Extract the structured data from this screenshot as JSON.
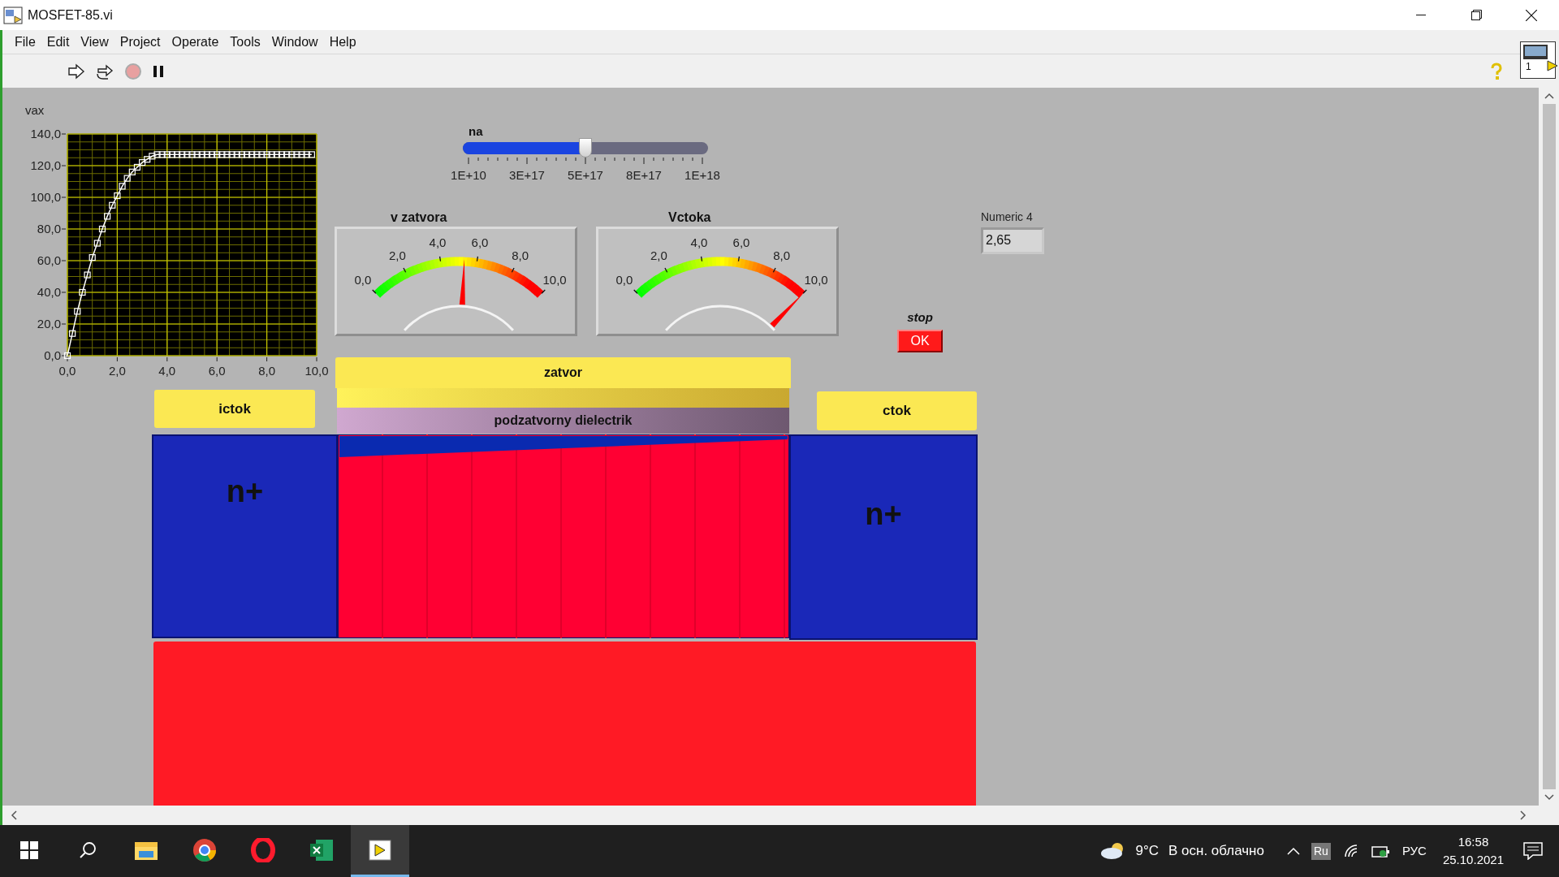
{
  "window": {
    "title": "MOSFET-85.vi",
    "vi_icon_text": "1"
  },
  "menu": [
    "File",
    "Edit",
    "View",
    "Project",
    "Operate",
    "Tools",
    "Window",
    "Help"
  ],
  "panel": {
    "graph": {
      "chart_data": {
        "type": "line",
        "grid": true,
        "x": [
          0,
          0.2,
          0.4,
          0.6,
          0.8,
          1.0,
          1.2,
          1.4,
          1.6,
          1.8,
          2.0,
          2.2,
          2.4,
          2.6,
          2.8,
          3.0,
          3.2,
          3.4,
          3.6,
          3.8,
          4.0,
          4.2,
          4.4,
          4.6,
          4.8,
          5.0,
          5.2,
          5.4,
          5.6,
          5.8,
          6.0,
          6.2,
          6.4,
          6.6,
          6.8,
          7.0,
          7.2,
          7.4,
          7.6,
          7.8,
          8.0,
          8.2,
          8.4,
          8.6,
          8.8,
          9.0,
          9.2,
          9.4,
          9.6,
          9.8
        ],
        "series": [
          {
            "name": "vax",
            "color": "#ffffff",
            "marker": "square",
            "values": [
              0,
              14,
              28,
              40,
              51,
              62,
              71,
              80,
              88,
              95,
              101,
              107,
              112,
              116,
              119,
              122,
              124,
              126,
              127,
              127,
              127,
              127,
              127,
              127,
              127,
              127,
              127,
              127,
              127,
              127,
              127,
              127,
              127,
              127,
              127,
              127,
              127,
              127,
              127,
              127,
              127,
              127,
              127,
              127,
              127,
              127,
              127,
              127,
              127,
              127
            ]
          }
        ],
        "xlim": [
          0,
          10
        ],
        "ylim": [
          0,
          140
        ],
        "xticks": [
          {
            "value": 0,
            "label": "0,0"
          },
          {
            "value": 2,
            "label": "2,0"
          },
          {
            "value": 4,
            "label": "4,0"
          },
          {
            "value": 6,
            "label": "6,0"
          },
          {
            "value": 8,
            "label": "8,0"
          },
          {
            "value": 10,
            "label": "10,0"
          }
        ],
        "yticks": [
          {
            "value": 0,
            "label": "0,0"
          },
          {
            "value": 20,
            "label": "20,0"
          },
          {
            "value": 40,
            "label": "40,0"
          },
          {
            "value": 60,
            "label": "60,0"
          },
          {
            "value": 80,
            "label": "80,0"
          },
          {
            "value": 100,
            "label": "100,0"
          },
          {
            "value": 120,
            "label": "120,0"
          },
          {
            "value": 140,
            "label": "140,0"
          }
        ]
      }
    },
    "slider": {
      "label": "na",
      "level": 0.5,
      "ticks": [
        "1E+10",
        "3E+17",
        "5E+17",
        "8E+17",
        "1E+18"
      ]
    },
    "gauges": [
      {
        "label": "v zatvora",
        "level": 0.53,
        "ticks": [
          "0,0",
          "2,0",
          "4,0",
          "6,0",
          "8,0",
          "10,0"
        ]
      },
      {
        "label": "Vctoka",
        "level": 1.0,
        "ticks": [
          "0,0",
          "2,0",
          "4,0",
          "6,0",
          "8,0",
          "10,0"
        ]
      }
    ],
    "numeric": {
      "label": "Numeric 4",
      "value": "2,65"
    },
    "stop": {
      "label": "stop",
      "button": "OK"
    },
    "device": {
      "gate": "zatvor",
      "dielectric": "podzatvorny dielectrik",
      "source_contact": "ictok",
      "drain_contact": "ctok",
      "source_region": "n+",
      "drain_region": "n+"
    }
  },
  "taskbar": {
    "weather_temp": "9°C",
    "weather_text": "В осн. облачно",
    "lang_badge": "Ru",
    "keyboard": "РУС",
    "time": "16:58",
    "date": "25.10.2021"
  }
}
